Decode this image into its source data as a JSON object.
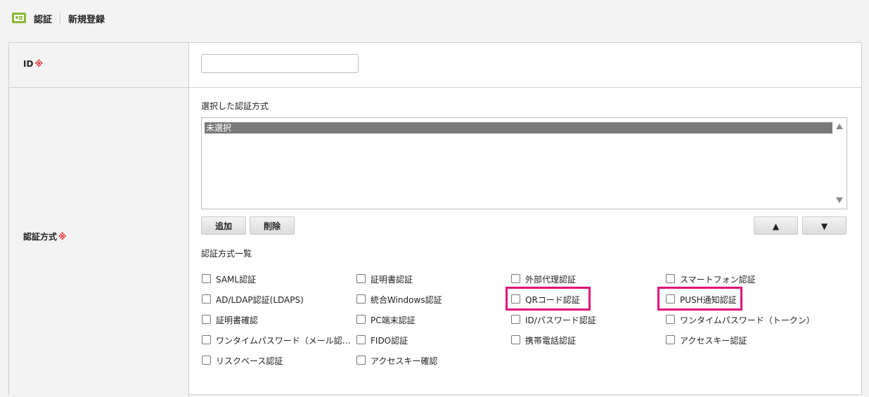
{
  "header": {
    "title": "認証",
    "subtitle": "新規登録",
    "icon": "id-card-icon"
  },
  "form": {
    "id_label": "ID",
    "required_mark": "※",
    "id_value": "",
    "auth_label": "認証方式",
    "selected_label": "選択した認証方式",
    "selected_items": [
      "未選択"
    ],
    "add_button": "追加",
    "delete_button": "削除",
    "up_button": "▲",
    "down_button": "▼",
    "list_label": "認証方式一覧",
    "methods": {
      "col1": [
        "SAML認証",
        "AD/LDAP認証(LDAPS)",
        "証明書確認",
        "ワンタイムパスワード（メール認…",
        "リスクベース認証"
      ],
      "col2": [
        "証明書認証",
        "統合Windows認証",
        "PC端末認証",
        "FIDO認証",
        "アクセスキー確認"
      ],
      "col3": [
        "外部代理認証",
        "QRコード認証",
        "ID/パスワード認証",
        "携帯電話認証"
      ],
      "col4": [
        "スマートフォン認証",
        "PUSH通知認証",
        "ワンタイムパスワード（トークン）",
        "アクセスキー認証"
      ]
    },
    "highlighted": [
      "QRコード認証",
      "PUSH通知認証"
    ],
    "highlight_color": "#e2117b"
  }
}
